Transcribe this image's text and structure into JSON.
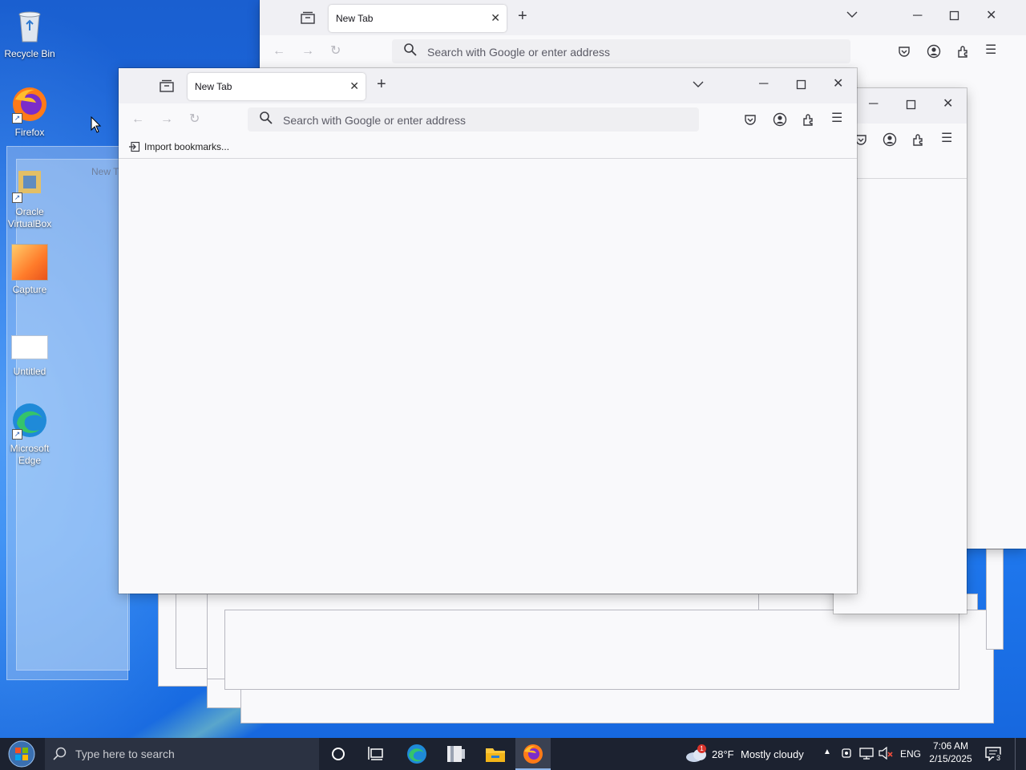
{
  "desktop": {
    "icons": [
      {
        "label": "Recycle Bin",
        "icon": "recycle-bin-icon"
      },
      {
        "label": "Firefox",
        "icon": "firefox-icon"
      },
      {
        "label": "Oracle VirtualBox",
        "icon": "virtualbox-icon"
      },
      {
        "label": "Capture",
        "icon": "capture-icon"
      },
      {
        "label": "Untitled",
        "icon": "untitled-icon"
      },
      {
        "label": "Microsoft Edge",
        "icon": "edge-icon"
      }
    ]
  },
  "browser": {
    "tab_title": "New Tab",
    "url_placeholder": "Search with Google or enter address",
    "import_bookmarks": "Import bookmarks..."
  },
  "ghost_tab_fragment": "New T",
  "taskbar": {
    "search_placeholder": "Type here to search",
    "weather_temp": "28°F",
    "weather_text": "Mostly cloudy",
    "weather_badge": "1",
    "language": "ENG",
    "time": "7:06 AM",
    "date": "2/15/2025",
    "notification_count": "3"
  },
  "colors": {
    "desktop_blue": "#1d6de6",
    "taskbar": "#1c2230",
    "browser_bg": "#f9f9fb",
    "tabstrip": "#f0f0f4"
  }
}
